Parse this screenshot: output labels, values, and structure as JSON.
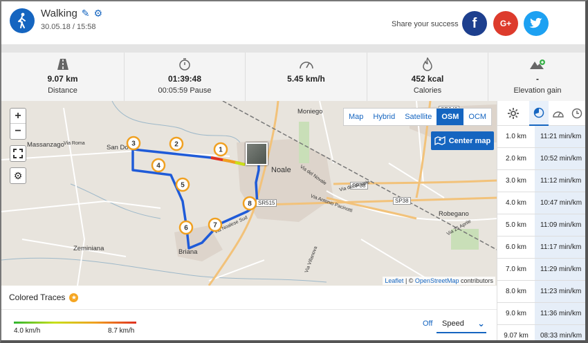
{
  "header": {
    "activity": "Walking",
    "datetime": "30.05.18 / 15:58",
    "share_text": "Share your success",
    "social": {
      "facebook": "f",
      "google": "G+",
      "twitter": "twitter"
    }
  },
  "stats": [
    {
      "value": "9.07 km",
      "label": "Distance"
    },
    {
      "value": "01:39:48",
      "label": "00:05:59 Pause"
    },
    {
      "value": "5.45 km/h",
      "label": ""
    },
    {
      "value": "452 kcal",
      "label": "Calories"
    },
    {
      "value": "-",
      "label": "Elevation gain"
    }
  ],
  "map": {
    "zoom_in": "+",
    "zoom_out": "−",
    "layers": [
      "Map",
      "Hybrid",
      "Satellite",
      "OSM",
      "OCM"
    ],
    "active_layer": "OSM",
    "center_map": "Center map",
    "attribution_leaflet": "Leaflet",
    "attribution_sep": " | © ",
    "attribution_osm": "OpenStreetMap",
    "attribution_rest": " contributors",
    "places": [
      "Massanzago",
      "San Do",
      "Moniego",
      "Noale",
      "Robegano",
      "Zeminiana",
      "Briana"
    ],
    "roads": [
      "SP38",
      "SR245",
      "SR515",
      "SP38"
    ],
    "street_labels": [
      "Via Roma",
      "Via del Novale",
      "Via Antonio Pacinotti",
      "Via Noalese Sud",
      "Via 25 Aprile",
      "Via Villanova",
      "Via del Novale"
    ],
    "markers": [
      "1",
      "2",
      "3",
      "4",
      "5",
      "6",
      "7",
      "8"
    ]
  },
  "traces": {
    "title": "Colored Traces",
    "min": "4.0 km/h",
    "max": "8.7 km/h",
    "off": "Off",
    "selected": "Speed",
    "colors": [
      "#2fb52f",
      "#c8e01a",
      "#f0a020",
      "#e03020"
    ]
  },
  "splits": [
    {
      "km": "1.0 km",
      "pace": "11:21 min/km"
    },
    {
      "km": "2.0 km",
      "pace": "10:52 min/km"
    },
    {
      "km": "3.0 km",
      "pace": "11:12 min/km"
    },
    {
      "km": "4.0 km",
      "pace": "10:47 min/km"
    },
    {
      "km": "5.0 km",
      "pace": "11:09 min/km"
    },
    {
      "km": "6.0 km",
      "pace": "11:17 min/km"
    },
    {
      "km": "7.0 km",
      "pace": "11:29 min/km"
    },
    {
      "km": "8.0 km",
      "pace": "11:23 min/km"
    },
    {
      "km": "9.0 km",
      "pace": "11:36 min/km"
    },
    {
      "km": "9.07 km",
      "pace": "08:33 min/km"
    }
  ],
  "accent_color": "#1565c0"
}
